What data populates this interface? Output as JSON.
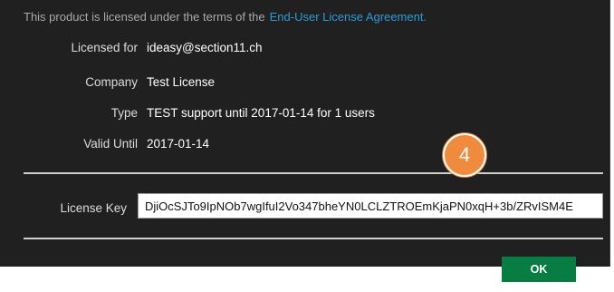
{
  "notice": {
    "text": "This product is licensed under the terms of the",
    "link_label": "End-User License Agreement."
  },
  "info": {
    "licensed_for_label": "Licensed for",
    "licensed_for_value": "ideasy@section11.ch",
    "company_label": "Company",
    "company_value": "Test License",
    "type_label": "Type",
    "type_value": "TEST support until 2017-01-14 for 1 users",
    "valid_until_label": "Valid Until",
    "valid_until_value": "2017-01-14"
  },
  "license_key": {
    "label": "License Key",
    "value": "DjiOcSJTo9IpNOb7wgIfuI2Vo347bheYN0LCLZTROEmKjaPN0xqH+3b/ZRvISM4E"
  },
  "buttons": {
    "ok_label": "OK"
  },
  "annotation": {
    "step_number": "4"
  },
  "colors": {
    "dialog_background": "#202020",
    "link": "#2e9ad6",
    "ok_button": "#087d43",
    "step_badge": "#f08a3c"
  }
}
